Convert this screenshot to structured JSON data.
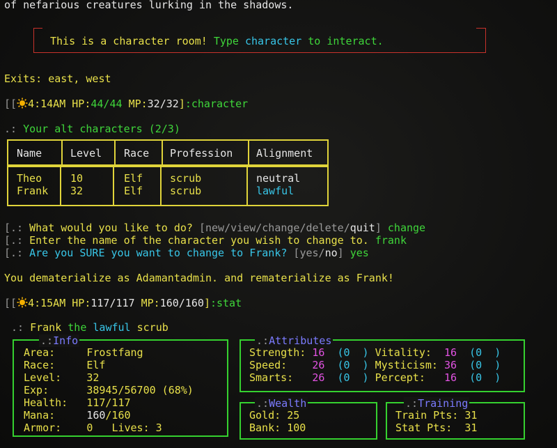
{
  "intro_line": "of nefarious creatures lurking in the shadows.",
  "banner": {
    "prefix": "This is a character room!",
    "type_word": "Type",
    "command": "character",
    "suffix": "to interact."
  },
  "exits": {
    "label": "Exits:",
    "value": "east, west"
  },
  "prompt1": {
    "time": "4:14AM",
    "hp_label": "HP:",
    "hp": "44/44",
    "mp_label": "MP:",
    "mp": "32/32",
    "command": "character"
  },
  "alt_heading": {
    "prefix": ".:",
    "text": "Your alt characters (2/3)"
  },
  "alt_table": {
    "headers": [
      "Name",
      "Level",
      "Race",
      "Profession",
      "Alignment"
    ],
    "rows": [
      {
        "name": "Theo",
        "level": "10",
        "race": "Elf",
        "profession": "scrub",
        "alignment": "neutral"
      },
      {
        "name": "Frank",
        "level": "32",
        "race": "Elf",
        "profession": "scrub",
        "alignment": "lawful"
      }
    ]
  },
  "menu": {
    "prompt_prefix": ".:",
    "question": "What would you like to do?",
    "opts": [
      "new",
      "view",
      "change",
      "delete",
      "quit"
    ],
    "answer": "change",
    "name_prompt": "Enter the name of the character you wish to change to.",
    "name_answer": "frank",
    "confirm_prompt": "Are you SURE you want to change to Frank?",
    "confirm_opts": [
      "yes",
      "no"
    ],
    "confirm_answer": "yes"
  },
  "dematerialize": "You dematerialize as Adamantadmin. and rematerialize as Frank!",
  "prompt2": {
    "time": "4:15AM",
    "hp_label": "HP:",
    "hp": "117/117",
    "mp_label": "MP:",
    "mp": "160/160",
    "command": "stat"
  },
  "stat_heading": {
    "prefix": ".:",
    "name": "Frank",
    "the": "the",
    "alignment": "lawful",
    "profession": "scrub"
  },
  "info": {
    "title": "Info",
    "area_label": "Area:",
    "area": "Frostfang",
    "race_label": "Race:",
    "race": "Elf",
    "level_label": "Level:",
    "level": "32",
    "exp_label": "Exp:",
    "exp": "38945/56700 (68%)",
    "health_label": "Health:",
    "health": "117/117",
    "mana_label": "Mana:",
    "mana_cur": "160",
    "mana_max": "/160",
    "armor_label": "Armor:",
    "armor": "0",
    "lives_label": "Lives:",
    "lives": "3"
  },
  "attributes": {
    "title": "Attributes",
    "rows": [
      {
        "l_label": "Strength:",
        "l_val": "16",
        "l_mod": "0",
        "r_label": "Vitality:",
        "r_val": "16",
        "r_mod": "0"
      },
      {
        "l_label": "Speed:",
        "l_val": "26",
        "l_mod": "0",
        "r_label": "Mysticism:",
        "r_val": "36",
        "r_mod": "0"
      },
      {
        "l_label": "Smarts:",
        "l_val": "26",
        "l_mod": "0",
        "r_label": "Percept:",
        "r_val": "16",
        "r_mod": "0"
      }
    ]
  },
  "wealth": {
    "title": "Wealth",
    "gold_label": "Gold:",
    "gold": "25",
    "bank_label": "Bank:",
    "bank": "100"
  },
  "training": {
    "title": "Training",
    "train_label": "Train Pts:",
    "train": "31",
    "stat_label": "Stat Pts:",
    "stat": "31"
  },
  "colors": {
    "yellow": "#e8e04a",
    "green": "#3fd63a",
    "cyan": "#38c6e8",
    "magenta": "#e353e3",
    "blue": "#7b7bff",
    "red": "#c8322b"
  }
}
